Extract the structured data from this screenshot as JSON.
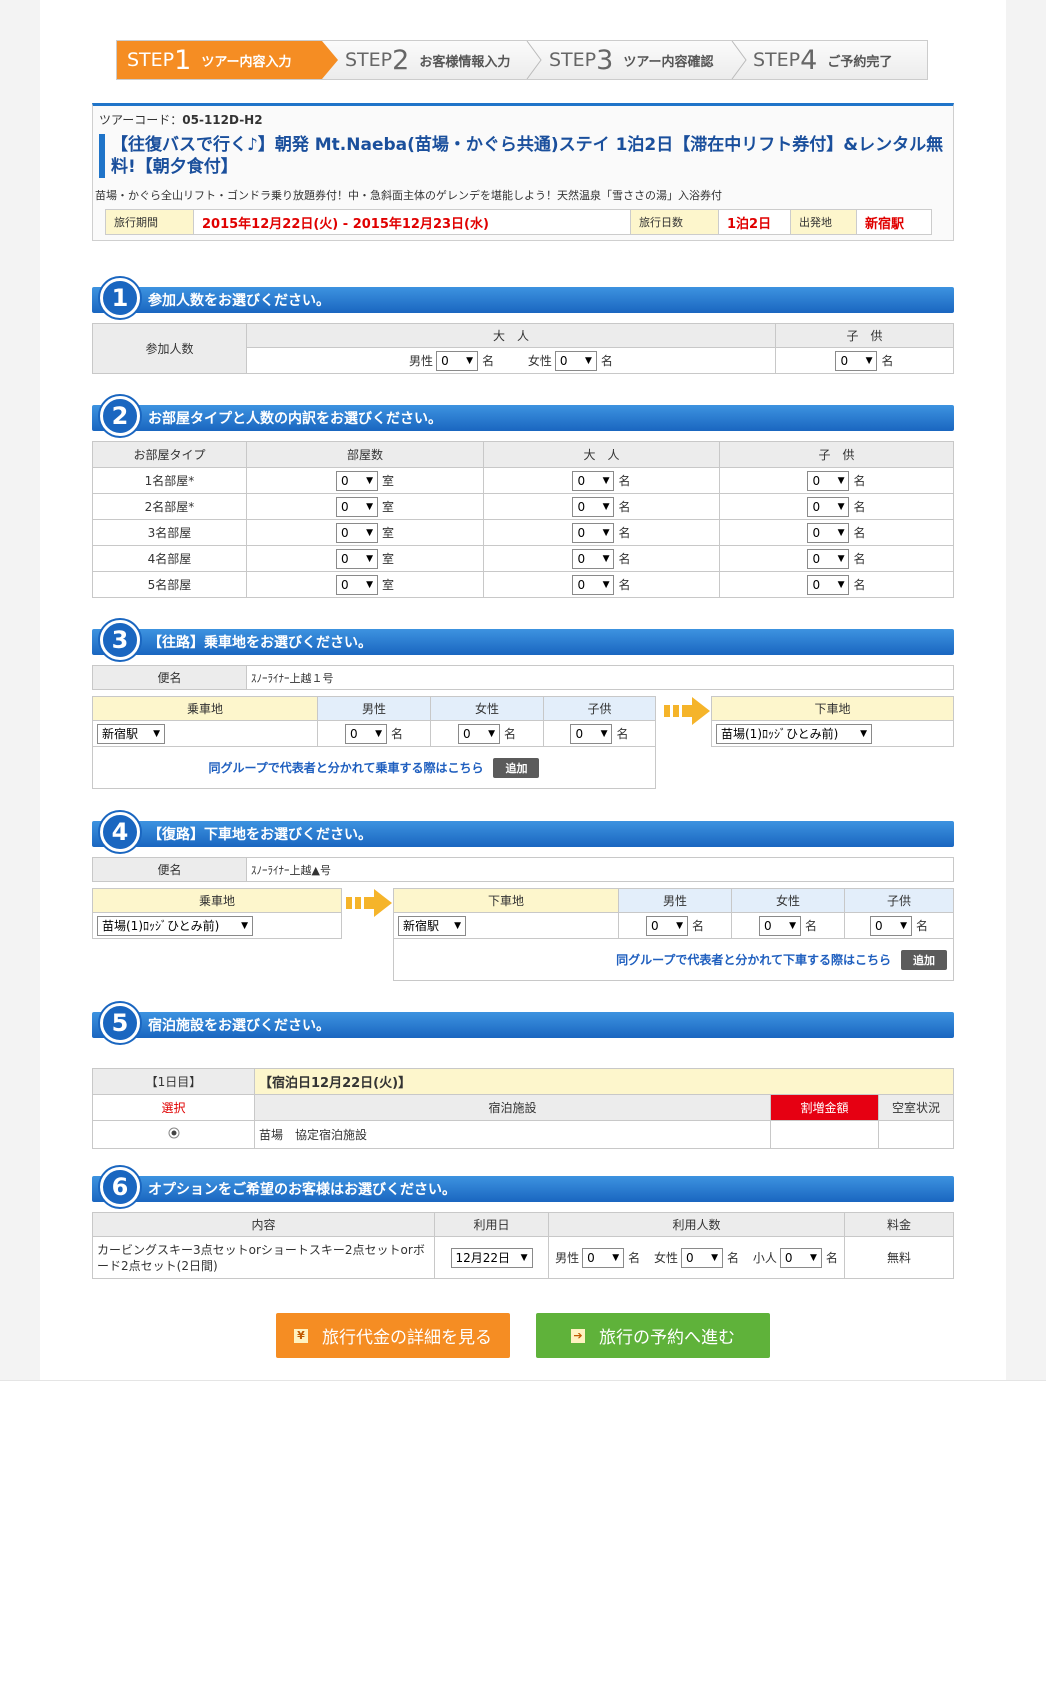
{
  "steps": [
    {
      "label": "STEP",
      "num": "1",
      "text": "ツアー内容入力"
    },
    {
      "label": "STEP",
      "num": "2",
      "text": "お客様情報入力"
    },
    {
      "label": "STEP",
      "num": "3",
      "text": "ツアー内容確認"
    },
    {
      "label": "STEP",
      "num": "4",
      "text": "ご予約完了"
    }
  ],
  "tour": {
    "code_label": "ツアーコード：",
    "code": "05-112D-H2",
    "title": "【往復バスで行く♪】朝発 Mt.Naeba(苗場・かぐら共通)ステイ 1泊2日【滞在中リフト券付】&レンタル無料!【朝夕食付】",
    "subtitle": "苗場・かぐら全山リフト・ゴンドラ乗り放題券付！中・急斜面主体のゲレンデを堪能しよう！天然温泉「雪ささの湯」入浴券付",
    "period_label": "旅行期間",
    "period": "2015年12月22日(火) - 2015年12月23日(水)",
    "days_label": "旅行日数",
    "days": "1泊2日",
    "departure_label": "出発地",
    "departure": "新宿駅"
  },
  "sec1": {
    "num": "1",
    "title": "参加人数をお選びください。",
    "row_label": "参加人数",
    "adult_header": "大　人",
    "child_header": "子　供",
    "male_label": "男性",
    "female_label": "女性",
    "male_value": "0",
    "female_value": "0",
    "child_value": "0",
    "unit": "名"
  },
  "sec2": {
    "num": "2",
    "title": "お部屋タイプと人数の内訳をお選びください。",
    "headers": [
      "お部屋タイプ",
      "部屋数",
      "大　人",
      "子　供"
    ],
    "room_unit": "室",
    "person_unit": "名",
    "rows": [
      {
        "type": "1名部屋*",
        "rooms": "0",
        "adults": "0",
        "children": "0"
      },
      {
        "type": "2名部屋*",
        "rooms": "0",
        "adults": "0",
        "children": "0"
      },
      {
        "type": "3名部屋",
        "rooms": "0",
        "adults": "0",
        "children": "0"
      },
      {
        "type": "4名部屋",
        "rooms": "0",
        "adults": "0",
        "children": "0"
      },
      {
        "type": "5名部屋",
        "rooms": "0",
        "adults": "0",
        "children": "0"
      }
    ]
  },
  "sec3": {
    "num": "3",
    "title": "【往路】乗車地をお選びください。",
    "bin_label": "便名",
    "bin_value": "ｽﾉｰﾗｲﾅｰ上越１号",
    "board_header": "乗車地",
    "male_header": "男性",
    "female_header": "女性",
    "child_header": "子供",
    "alight_header": "下車地",
    "board_value": "新宿駅",
    "male_value": "0",
    "female_value": "0",
    "child_value": "0",
    "alight_value": "苗場(1)ﾛｯｼﾞひとみ前)",
    "unit": "名",
    "group_link": "同グループで代表者と分かれて乗車する際はこちら",
    "add_label": "追加"
  },
  "sec4": {
    "num": "4",
    "title": "【復路】下車地をお選びください。",
    "bin_label": "便名",
    "bin_value": "ｽﾉｰﾗｲﾅｰ上越▲号",
    "board_header": "乗車地",
    "alight_header": "下車地",
    "male_header": "男性",
    "female_header": "女性",
    "child_header": "子供",
    "board_value": "苗場(1)ﾛｯｼﾞひとみ前)",
    "alight_value": "新宿駅",
    "male_value": "0",
    "female_value": "0",
    "child_value": "0",
    "unit": "名",
    "group_link": "同グループで代表者と分かれて下車する際はこちら",
    "add_label": "追加"
  },
  "sec5": {
    "num": "5",
    "title": "宿泊施設をお選びください。",
    "day_label": "【1日目】",
    "stay_date": "【宿泊日12月22日(火)】",
    "select_header": "選択",
    "facility_header": "宿泊施設",
    "surcharge_header": "割増金額",
    "vacancy_header": "空室状況",
    "facility": "苗場　協定宿泊施設",
    "selected": true
  },
  "sec6": {
    "num": "6",
    "title": "オプションをご希望のお客様はお選びください。",
    "headers": [
      "内容",
      "利用日",
      "利用人数",
      "料金"
    ],
    "content": "カービングスキー3点セットorショートスキー2点セットorボード2点セット(2日間)",
    "date_value": "12月22日",
    "male_label": "男性",
    "female_label": "女性",
    "kid_label": "小人",
    "male_value": "0",
    "female_value": "0",
    "kid_value": "0",
    "unit": "名",
    "price": "無料"
  },
  "buttons": {
    "detail_icon": "¥",
    "detail_label": "旅行代金の詳細を見る",
    "detail_color": "#f58d23",
    "reserve_icon": "➔",
    "reserve_label": "旅行の予約へ進む",
    "reserve_color": "#5fb23a"
  }
}
